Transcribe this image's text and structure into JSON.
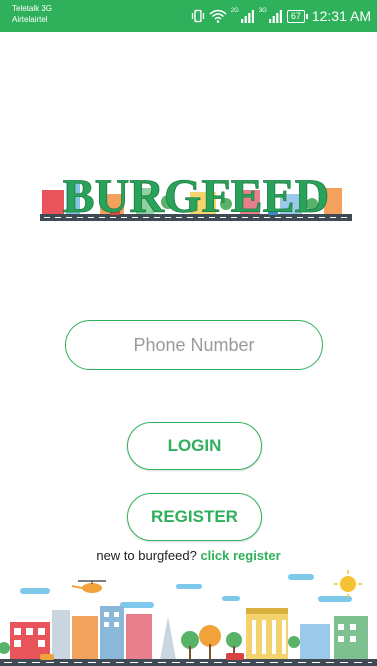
{
  "status_bar": {
    "carrier_primary": "Teletalk 3G",
    "carrier_secondary": "Airtelairtel",
    "net_tag_1": "2G",
    "net_tag_2": "3G",
    "battery": "67",
    "time": "12:31 AM",
    "icons": [
      "vibrate-icon",
      "wifi-icon",
      "signal-icon",
      "signal-icon"
    ]
  },
  "logo": {
    "text": "BURGFEED"
  },
  "form": {
    "phone_placeholder": "Phone Number",
    "phone_value": "",
    "login_label": "LOGIN",
    "register_label": "REGISTER"
  },
  "signup": {
    "prompt": "new to burgfeed?",
    "link": "click register"
  },
  "colors": {
    "accent": "#2fb05b",
    "status_bar": "#2fb05b",
    "text": "#222222",
    "placeholder": "#9a9a9a"
  }
}
